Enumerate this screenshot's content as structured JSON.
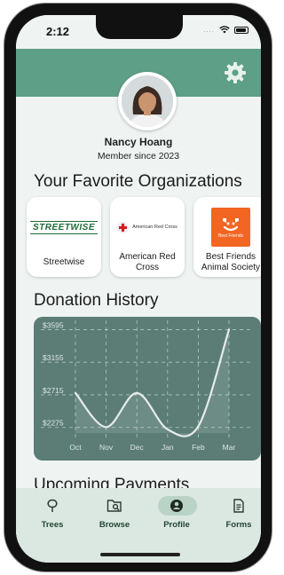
{
  "status_bar": {
    "time": "2:12",
    "signal_dots": "....",
    "icons": [
      "wifi-icon",
      "battery-icon"
    ]
  },
  "header": {
    "settings_icon": "gear-icon",
    "band_color": "#5e9f87"
  },
  "profile": {
    "name": "Nancy Hoang",
    "member_since": "Member since 2023",
    "avatar_icon": "avatar"
  },
  "favorites": {
    "title": "Your Favorite Organizations",
    "orgs": [
      {
        "name": "Streetwise",
        "logo_text": "STREETWISE",
        "logo_color": "#1d6b36"
      },
      {
        "name": "American Red Cross",
        "logo_text": "American Red Cross",
        "logo_color": "#d71920"
      },
      {
        "name": "Best Friends Animal Society",
        "logo_text": "Best Friends",
        "logo_color": "#f26522"
      }
    ]
  },
  "donation_history": {
    "title": "Donation History",
    "panel_color": "#5b7d76",
    "chart_data": {
      "type": "line",
      "x": [
        "Oct",
        "Nov",
        "Dec",
        "Jan",
        "Feb",
        "Mar"
      ],
      "y_ticks": [
        "$3595",
        "$3155",
        "$2715",
        "$2275"
      ],
      "ylim": [
        2200,
        3600
      ],
      "grid": true,
      "series": [
        {
          "x": [
            "Oct",
            "Nov",
            "Dec",
            "Jan",
            "Feb",
            "Mar"
          ],
          "values": [
            2740,
            2280,
            2740,
            2250,
            2290,
            3595
          ]
        }
      ]
    }
  },
  "upcoming": {
    "title": "Upcoming Payments"
  },
  "tabbar": {
    "active": "Profile",
    "tabs": [
      {
        "label": "Trees",
        "icon": "tree-icon"
      },
      {
        "label": "Browse",
        "icon": "browse-icon"
      },
      {
        "label": "Profile",
        "icon": "profile-icon"
      },
      {
        "label": "Forms",
        "icon": "forms-icon"
      }
    ]
  }
}
